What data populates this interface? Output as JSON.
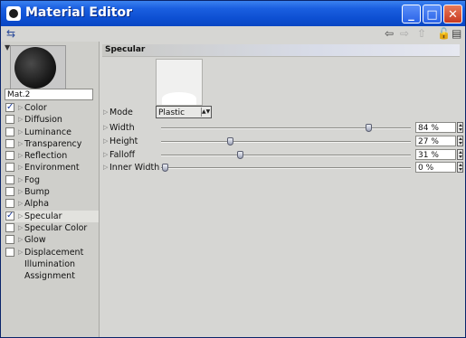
{
  "window": {
    "title": "Material Editor"
  },
  "material": {
    "name": "Mat.2"
  },
  "channels": [
    {
      "label": "Color",
      "checked": true
    },
    {
      "label": "Diffusion",
      "checked": false
    },
    {
      "label": "Luminance",
      "checked": false
    },
    {
      "label": "Transparency",
      "checked": false
    },
    {
      "label": "Reflection",
      "checked": false
    },
    {
      "label": "Environment",
      "checked": false
    },
    {
      "label": "Fog",
      "checked": false
    },
    {
      "label": "Bump",
      "checked": false
    },
    {
      "label": "Alpha",
      "checked": false
    },
    {
      "label": "Specular",
      "checked": true,
      "selected": true
    },
    {
      "label": "Specular Color",
      "checked": false
    },
    {
      "label": "Glow",
      "checked": false
    },
    {
      "label": "Displacement",
      "checked": false
    },
    {
      "label": "Illumination"
    },
    {
      "label": "Assignment"
    }
  ],
  "specular": {
    "section_title": "Specular",
    "mode": {
      "label": "Mode",
      "value": "Plastic"
    },
    "width": {
      "label": "Width",
      "value": "84 %",
      "percent": 84
    },
    "height": {
      "label": "Height",
      "value": "27 %",
      "percent": 27
    },
    "falloff": {
      "label": "Falloff",
      "value": "31 %",
      "percent": 31
    },
    "inner_width": {
      "label": "Inner Width",
      "value": "0 %",
      "percent": 0
    }
  },
  "icons": [
    "material-icon",
    "minimize-icon",
    "maximize-icon",
    "close-icon",
    "pin-icon",
    "back-arrow-icon",
    "forward-arrow-icon",
    "up-arrow-icon",
    "lock-icon",
    "layout-icon"
  ]
}
